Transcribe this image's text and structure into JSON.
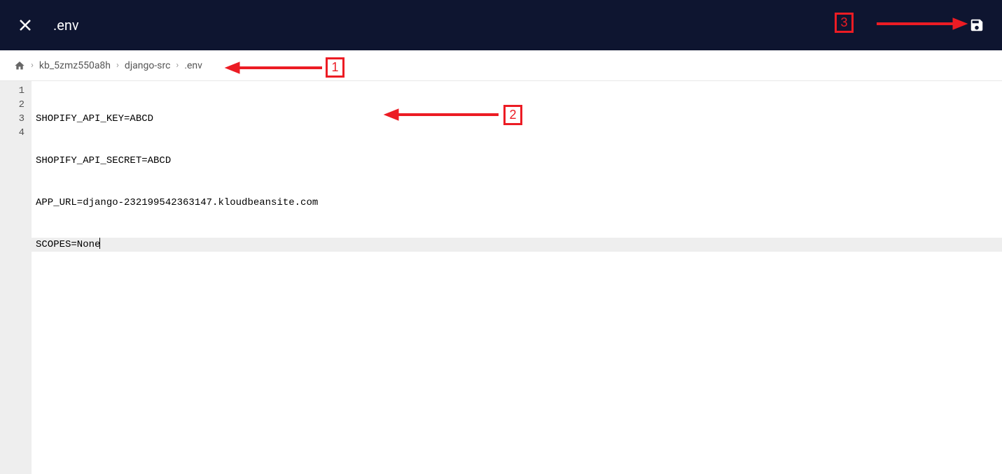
{
  "header": {
    "title": ".env"
  },
  "breadcrumb": {
    "items": [
      "kb_5zmz550a8h",
      "django-src",
      ".env"
    ]
  },
  "editor": {
    "lines": [
      "SHOPIFY_API_KEY=ABCD",
      "SHOPIFY_API_SECRET=ABCD",
      "APP_URL=django-232199542363147.kloudbeansite.com",
      "SCOPES=None"
    ],
    "active_line": 4
  },
  "annotations": {
    "1": "1",
    "2": "2",
    "3": "3"
  }
}
